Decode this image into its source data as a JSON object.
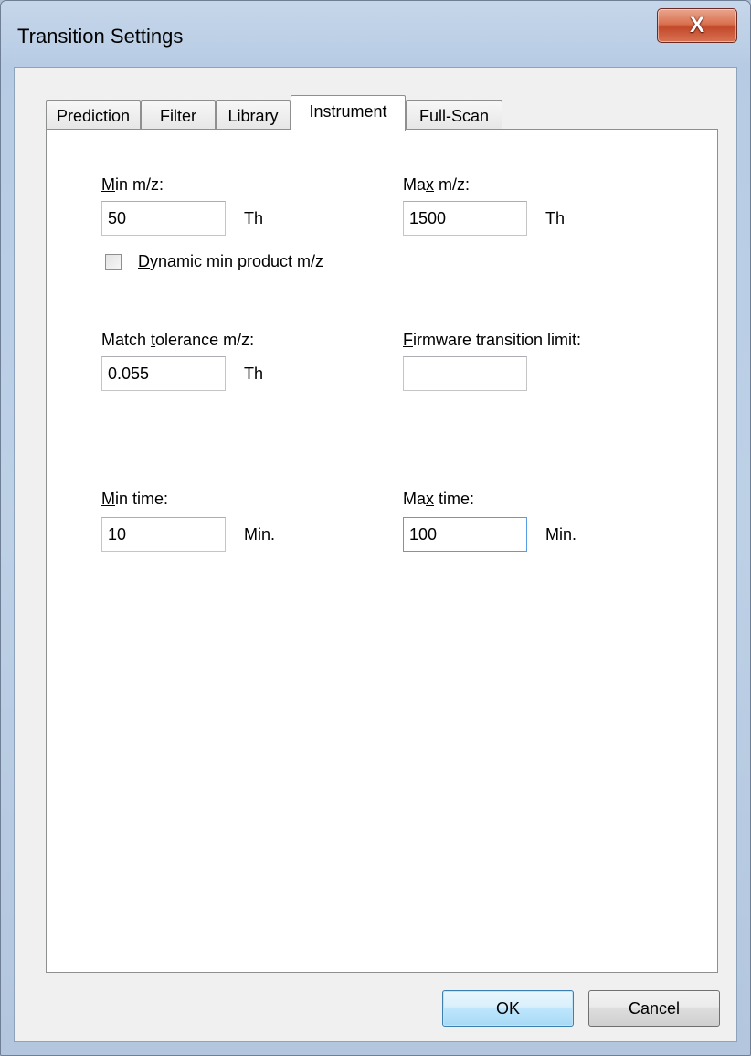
{
  "window": {
    "title": "Transition Settings",
    "close_glyph": "X"
  },
  "tabs": [
    {
      "label": "Prediction"
    },
    {
      "label": "Filter"
    },
    {
      "label": "Library"
    },
    {
      "label": "Instrument",
      "active": true
    },
    {
      "label": "Full-Scan"
    }
  ],
  "instrument": {
    "min_mz": {
      "mnemonic": "M",
      "label_rest": "in m/z:",
      "value": "50",
      "unit": "Th"
    },
    "max_mz": {
      "label_pre": "Ma",
      "mnemonic": "x",
      "label_rest": " m/z:",
      "value": "1500",
      "unit": "Th"
    },
    "dynamic_min": {
      "mnemonic": "D",
      "label_rest": "ynamic min product m/z",
      "checked": false
    },
    "match_tolerance": {
      "label_pre": "Match ",
      "mnemonic": "t",
      "label_rest": "olerance m/z:",
      "value": "0.055",
      "unit": "Th"
    },
    "firmware_limit": {
      "mnemonic": "F",
      "label_rest": "irmware transition limit:",
      "value": ""
    },
    "min_time": {
      "mnemonic": "M",
      "label_rest": "in time:",
      "value": "10",
      "unit": "Min."
    },
    "max_time": {
      "label_pre": "Ma",
      "mnemonic": "x",
      "label_rest": " time:",
      "value": "100",
      "unit": "Min."
    }
  },
  "buttons": {
    "ok": "OK",
    "cancel": "Cancel"
  },
  "icons": {
    "checkbox": "checkbox-unchecked",
    "close": "close-icon"
  }
}
